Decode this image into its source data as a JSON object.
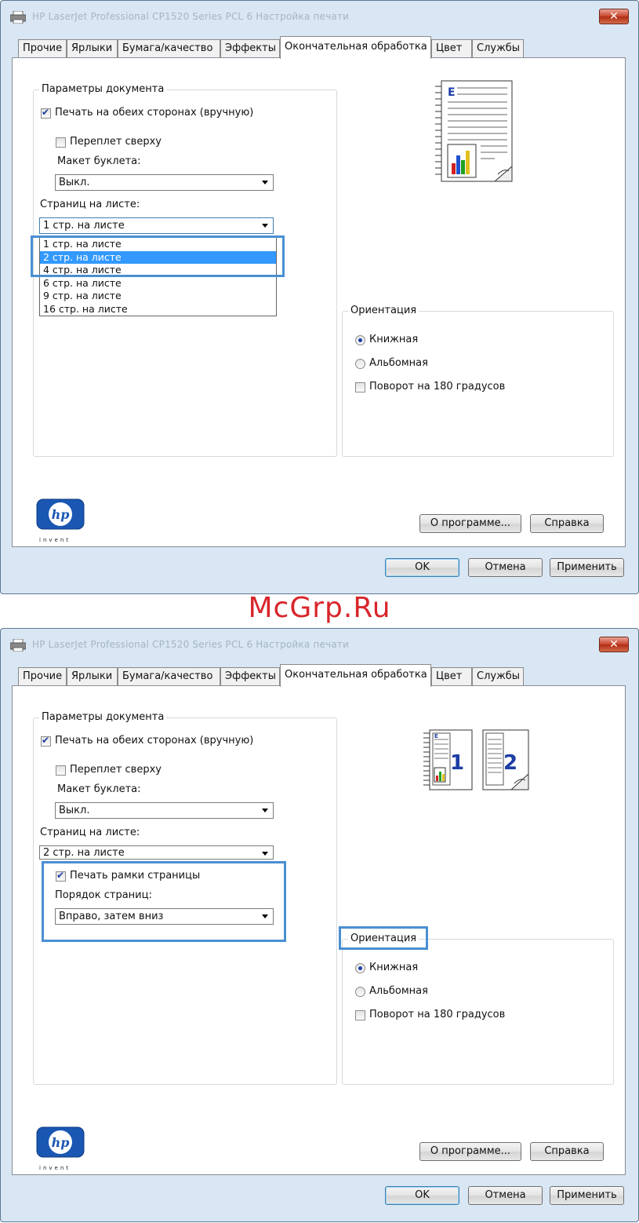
{
  "title": "HP LaserJet Professional CP1520 Series PCL 6 Настройка печати",
  "close_symbol": "✕",
  "tabs": [
    "Прочие",
    "Ярлыки",
    "Бумага/качество",
    "Эффекты",
    "Окончательная обработка",
    "Цвет",
    "Службы"
  ],
  "watermark": "McGrp.Ru",
  "doc_options": {
    "legend": "Параметры документа",
    "duplex_label": "Печать на обеих сторонах (вручную)",
    "flip_label": "Переплет сверху",
    "booklet_label": "Макет буклета:",
    "booklet_value": "Выкл.",
    "pages_label": "Страниц на листе:"
  },
  "screen1": {
    "pages_value": "1 стр. на листе",
    "options": [
      "1 стр. на листе",
      "2 стр. на листе",
      "4 стр. на листе",
      "6 стр. на листе",
      "9 стр. на листе",
      "16 стр. на листе"
    ],
    "selected_index": 1
  },
  "screen2": {
    "pages_value": "2 стр. на листе",
    "borders_label": "Печать рамки страницы",
    "order_label": "Порядок страниц:",
    "order_value": "Вправо, затем вниз",
    "preview_page1": "1",
    "preview_page2": "2"
  },
  "orientation": {
    "legend": "Ориентация",
    "portrait": "Книжная",
    "landscape": "Альбомная",
    "rotate": "Поворот на 180 градусов"
  },
  "buttons": {
    "about": "О программе...",
    "help": "Справка",
    "ok": "OK",
    "cancel": "Отмена",
    "apply": "Применить"
  },
  "logo": {
    "mark": "hp",
    "tagline": "invent"
  },
  "preview_letter": "E",
  "colors": {
    "highlight": "#4a8fd2",
    "selection": "#3399ff",
    "accent": "#1c3ea5"
  }
}
